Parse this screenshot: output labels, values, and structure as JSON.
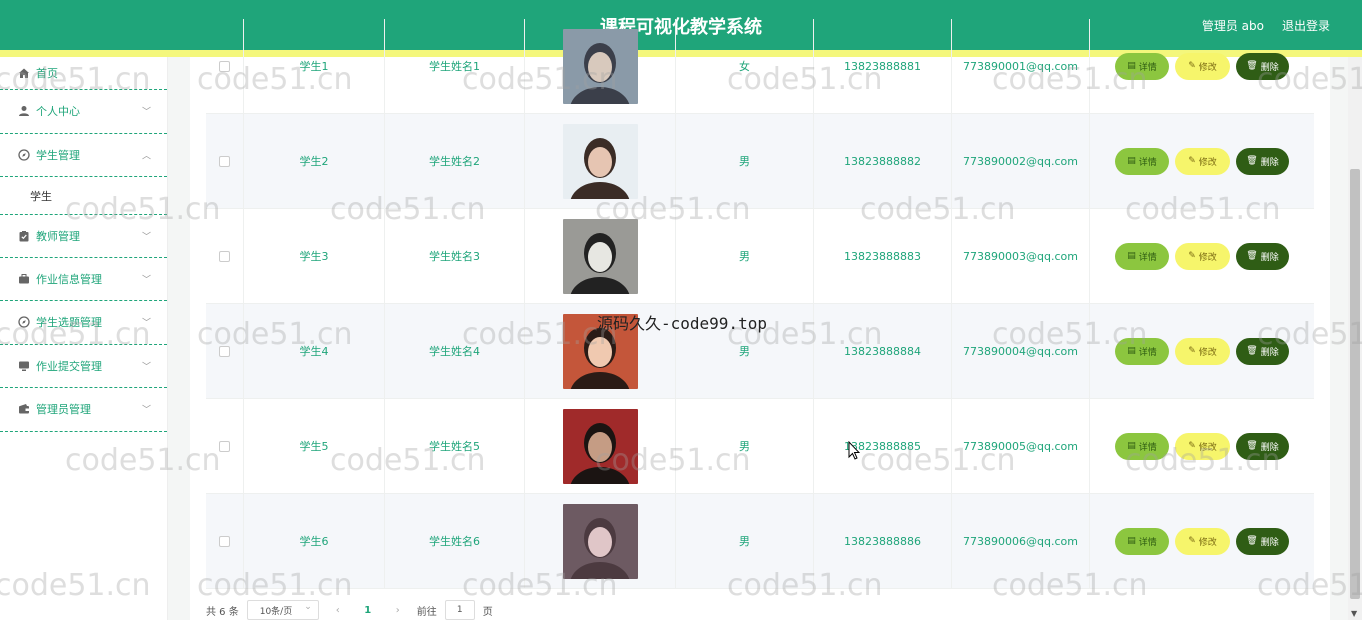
{
  "header": {
    "title": "课程可视化教学系统",
    "user_label": "管理员 abo",
    "logout_label": "退出登录"
  },
  "sidebar": {
    "items": [
      {
        "label": "首页",
        "icon": "home-icon",
        "expandable": false
      },
      {
        "label": "个人中心",
        "icon": "user-icon",
        "expandable": true
      },
      {
        "label": "学生管理",
        "icon": "compass-icon",
        "expandable": true,
        "expanded": true,
        "children": [
          {
            "label": "学生"
          }
        ]
      },
      {
        "label": "教师管理",
        "icon": "clipboard-icon",
        "expandable": true
      },
      {
        "label": "作业信息管理",
        "icon": "briefcase-icon",
        "expandable": true
      },
      {
        "label": "学生选题管理",
        "icon": "compass-icon",
        "expandable": true
      },
      {
        "label": "作业提交管理",
        "icon": "monitor-icon",
        "expandable": true
      },
      {
        "label": "管理员管理",
        "icon": "wallet-icon",
        "expandable": true
      }
    ]
  },
  "table": {
    "rows": [
      {
        "id": "学生1",
        "name": "学生姓名1",
        "sex": "女",
        "phone": "13823888881",
        "email": "773890001@qq.com",
        "photo_colors": [
          "#8a9aa8",
          "#3b3f4a",
          "#d8c9bd"
        ]
      },
      {
        "id": "学生2",
        "name": "学生姓名2",
        "sex": "男",
        "phone": "13823888882",
        "email": "773890002@qq.com",
        "photo_colors": [
          "#e8eef2",
          "#3b2c26",
          "#e6c5b2"
        ]
      },
      {
        "id": "学生3",
        "name": "学生姓名3",
        "sex": "男",
        "phone": "13823888883",
        "email": "773890003@qq.com",
        "photo_colors": [
          "#9a9a96",
          "#222222",
          "#e7e7e2"
        ]
      },
      {
        "id": "学生4",
        "name": "学生姓名4",
        "sex": "男",
        "phone": "13823888884",
        "email": "773890004@qq.com",
        "photo_colors": [
          "#c4563a",
          "#2b1b16",
          "#f0c9b0"
        ]
      },
      {
        "id": "学生5",
        "name": "学生姓名5",
        "sex": "男",
        "phone": "13823888885",
        "email": "773890005@qq.com",
        "photo_colors": [
          "#a02a2a",
          "#1b1412",
          "#c59c84"
        ]
      },
      {
        "id": "学生6",
        "name": "学生姓名6",
        "sex": "男",
        "phone": "13823888886",
        "email": "773890006@qq.com",
        "photo_colors": [
          "#6d5a62",
          "#4c3a40",
          "#e0c6c8"
        ]
      }
    ],
    "buttons": {
      "detail": "详情",
      "edit": "修改",
      "delete": "删除"
    }
  },
  "pagination": {
    "total_label": "共 6 条",
    "page_size": "10条/页",
    "current_page": "1",
    "goto_label": "前往",
    "goto_value": "1",
    "page_unit": "页"
  },
  "watermarks": {
    "repeat_text": "code51.cn",
    "center_text": "源码久久-code99.top"
  },
  "colors": {
    "primary": "#1fa57a",
    "accent_strip": "#f4f77c",
    "btn_detail": "#8cc63f",
    "btn_edit": "#f6f56b",
    "btn_delete": "#2f5d15"
  }
}
